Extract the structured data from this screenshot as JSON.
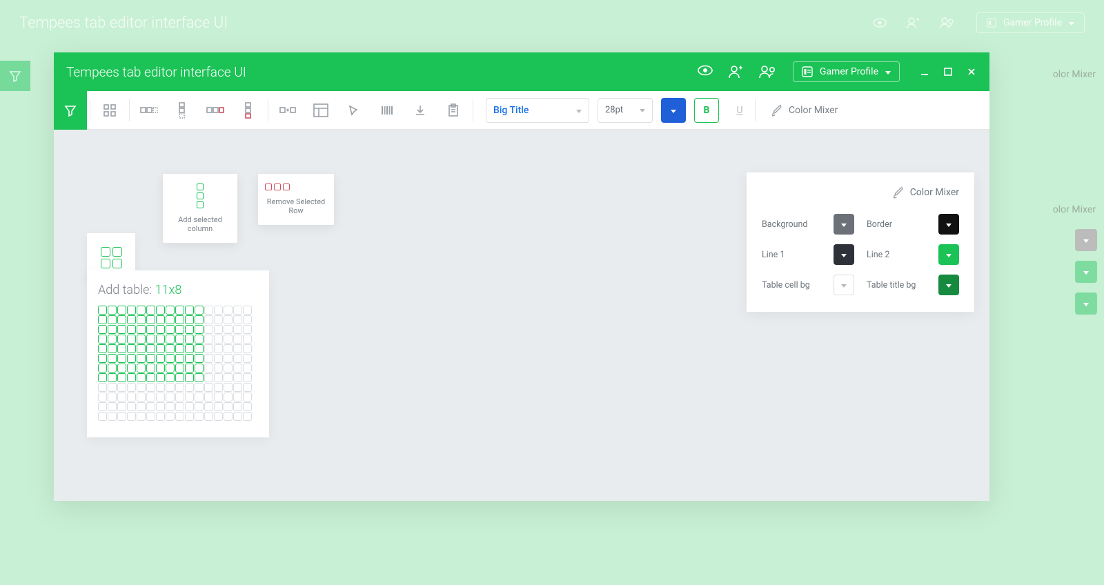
{
  "app_title": "Tempees tab editor interface UI",
  "profile_label": "Gamer Profile",
  "toolbar": {
    "style_select": "Big Title",
    "font_size": "28pt",
    "bold_label": "B",
    "underline_label": "U",
    "color_mixer_label": "Color Mixer"
  },
  "popups": {
    "add_col": "Add selected column",
    "remove_row": "Remove Selected Row"
  },
  "table_picker": {
    "prefix": "Add table: ",
    "dims": "11x8",
    "cols": 16,
    "rows": 12,
    "sel_cols": 11,
    "sel_rows": 8
  },
  "color_mixer": {
    "title": "Color Mixer",
    "items": [
      {
        "label": "Background",
        "swatch": "sw-grey"
      },
      {
        "label": "Border",
        "swatch": "sw-black"
      },
      {
        "label": "Line 1",
        "swatch": "sw-dark"
      },
      {
        "label": "Line 2",
        "swatch": "sw-green"
      },
      {
        "label": "Table cell bg",
        "swatch": "sw-white"
      },
      {
        "label": "Table title bg",
        "swatch": "sw-dgreen"
      }
    ]
  },
  "bg": {
    "right_label_1": "olor Mixer",
    "right_label_2": "olor Mixer"
  }
}
